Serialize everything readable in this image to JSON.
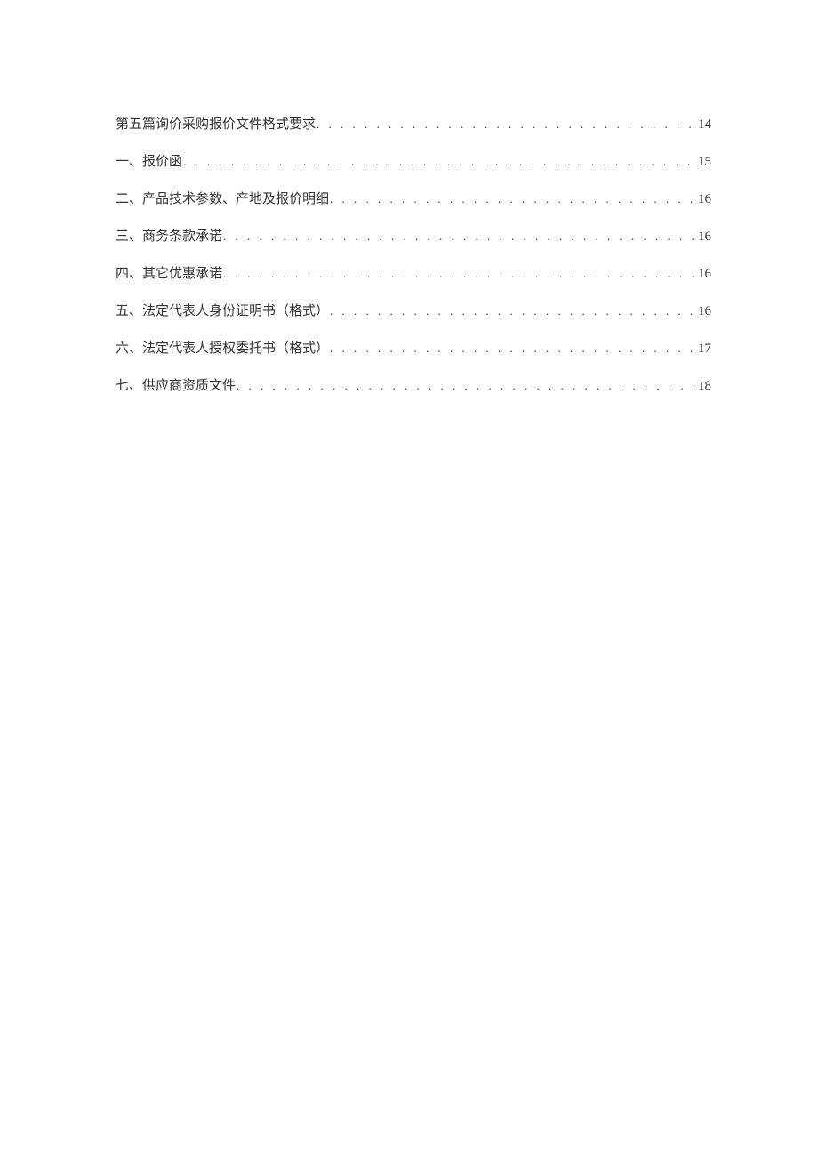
{
  "toc": {
    "entries": [
      {
        "title": "第五篇询价采购报价文件格式要求",
        "page": "14"
      },
      {
        "title": "一、报价函",
        "page": "15"
      },
      {
        "title": "二、产品技术参数、产地及报价明细",
        "page": "16"
      },
      {
        "title": "三、商务条款承诺",
        "page": "16"
      },
      {
        "title": "四、其它优惠承诺",
        "page": "16"
      },
      {
        "title": "五、法定代表人身份证明书（格式）",
        "page": "16"
      },
      {
        "title": "六、法定代表人授权委托书（格式）",
        "page": "17"
      },
      {
        "title": "七、供应商资质文件",
        "page": "18"
      }
    ]
  },
  "dots_fill": ". . . . . . . . . . . . . . . . . . . . . . . . . . . . . . . . . . . . . . . . . . . . . . . . . . . . . . . . . . . . . . . . . . . . . . . . . . . . . . . . . . . . . . . . . . . . . . . . . . . . . . . . . . . . . . . . . . . . . . . ."
}
